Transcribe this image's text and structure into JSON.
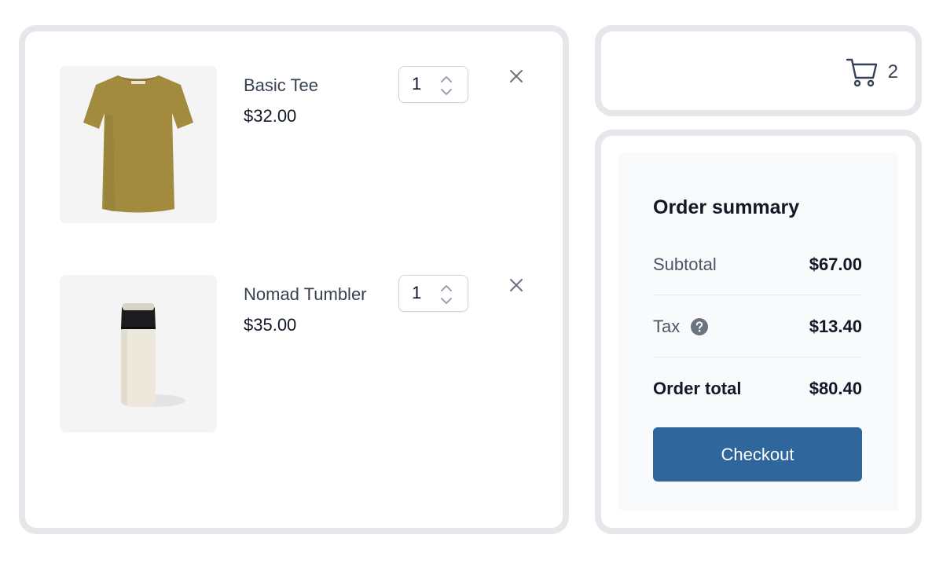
{
  "cart": {
    "items": [
      {
        "name": "Basic Tee",
        "price": "$32.00",
        "quantity": "1",
        "image": "olive-tshirt",
        "remove_icon": "close-icon"
      },
      {
        "name": "Nomad Tumbler",
        "price": "$35.00",
        "quantity": "1",
        "image": "white-tumbler",
        "remove_icon": "close-icon"
      }
    ]
  },
  "header": {
    "cart_icon": "shopping-cart-icon",
    "cart_count": "2"
  },
  "summary": {
    "title": "Order summary",
    "subtotal_label": "Subtotal",
    "subtotal_value": "$67.00",
    "tax_label": "Tax",
    "tax_help_icon": "question-circle-icon",
    "tax_value": "$13.40",
    "total_label": "Order total",
    "total_value": "$80.40",
    "checkout_label": "Checkout"
  },
  "colors": {
    "panel_border": "#e5e7eb",
    "summary_background": "#f9fafb",
    "checkout_button": "#2f679d",
    "icon_gray": "#6b7280"
  }
}
